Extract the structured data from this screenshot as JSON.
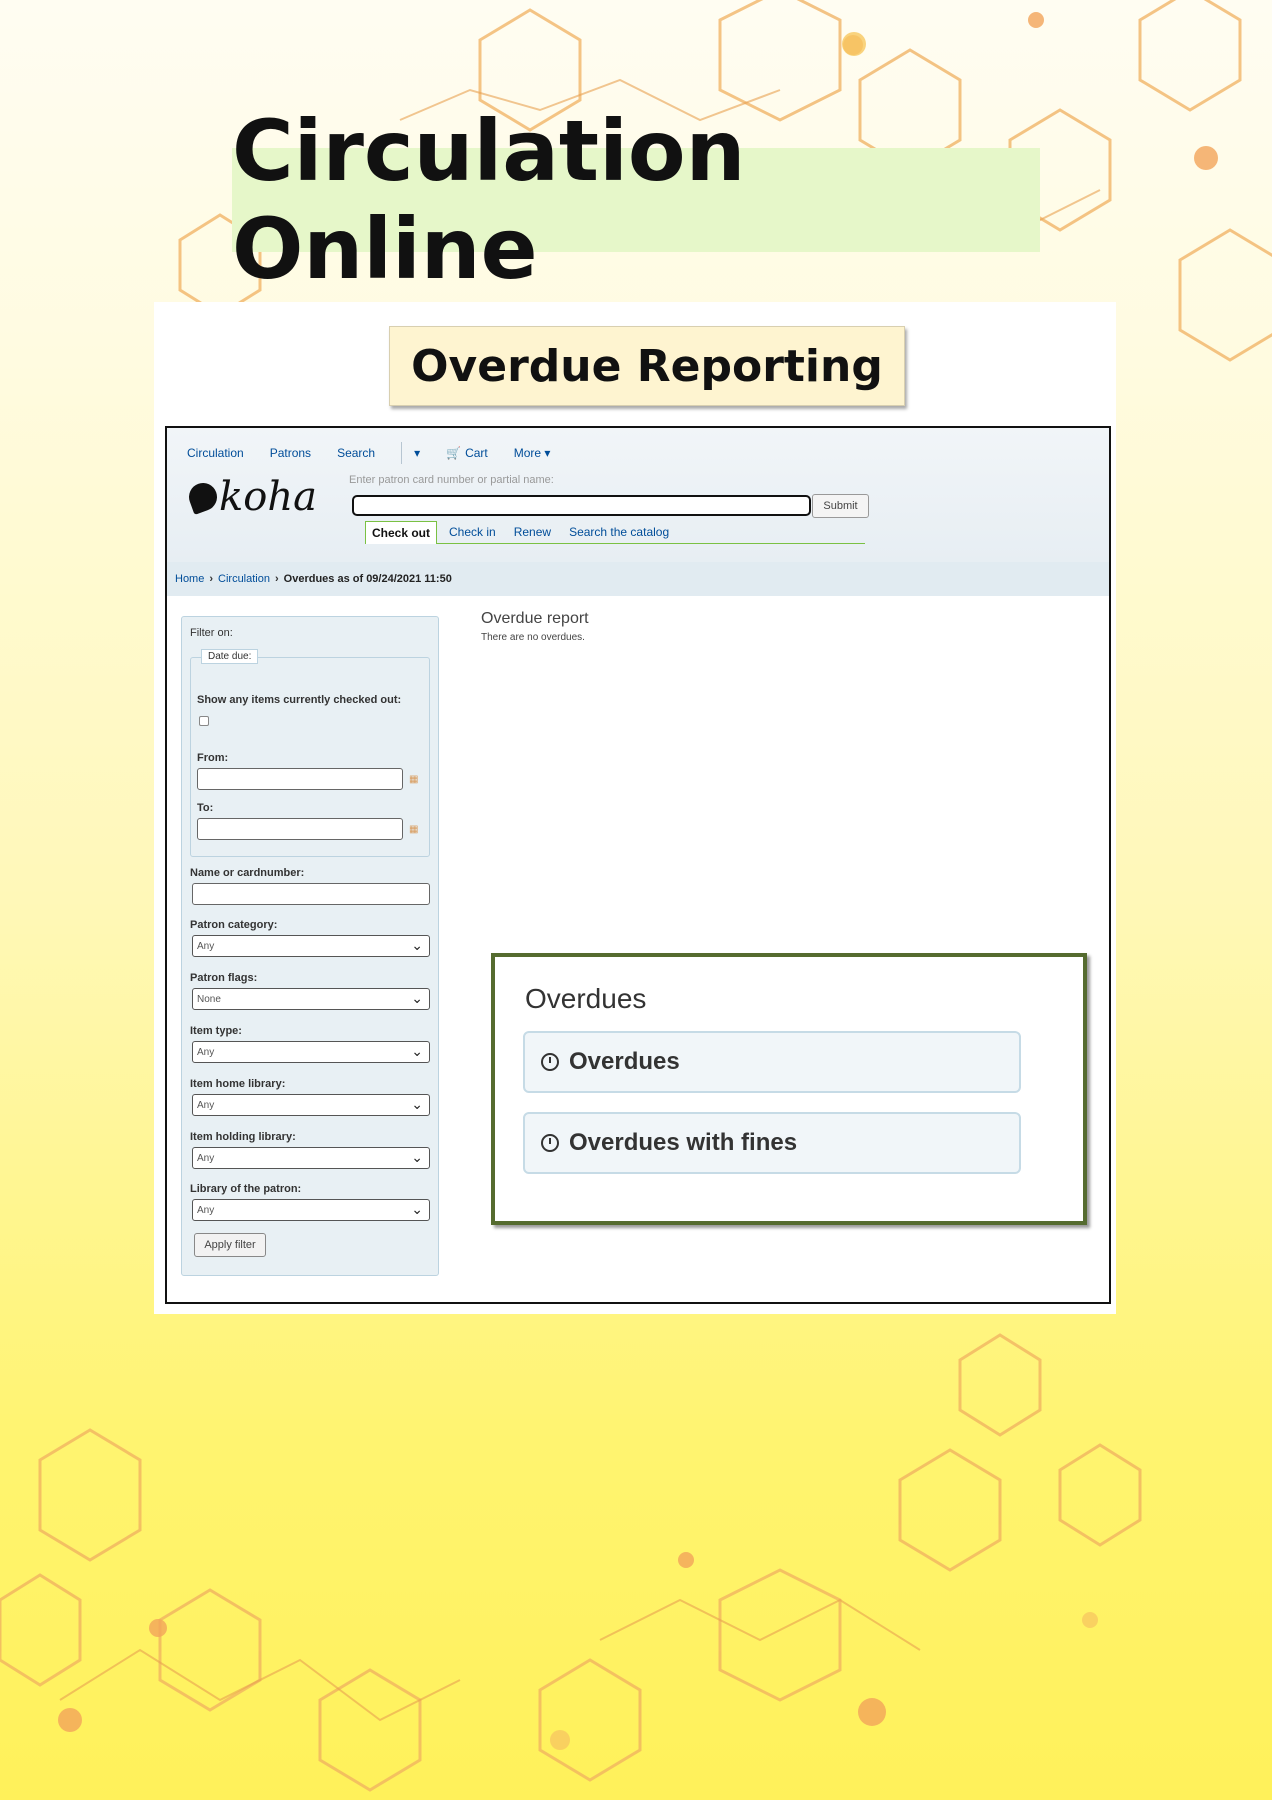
{
  "poster": {
    "title": "Circulation Online",
    "subtitle": "Overdue Reporting"
  },
  "colors": {
    "link": "#004d99",
    "title_highlight": "#e6f7c9",
    "overlay_border": "#556b2f",
    "active_tab_border": "#7ac143"
  },
  "koha": {
    "nav": {
      "circulation": "Circulation",
      "patrons": "Patrons",
      "search": "Search",
      "dropdown": "▾",
      "cart": "Cart",
      "more": "More ▾"
    },
    "logo_text": "koha",
    "search": {
      "hint": "Enter patron card number or partial name:",
      "value": "",
      "submit": "Submit"
    },
    "tabs": {
      "checkout": "Check out",
      "checkin": "Check in",
      "renew": "Renew",
      "catalog": "Search the catalog"
    },
    "breadcrumb": {
      "home": "Home",
      "circulation": "Circulation",
      "current": "Overdues as of 09/24/2021 11:50"
    },
    "filter": {
      "heading": "Filter on:",
      "legend": "Date due:",
      "show_checked_out": "Show any items currently checked out:",
      "from": "From:",
      "to": "To:",
      "name_or_card": "Name or cardnumber:",
      "patron_category": "Patron category:",
      "patron_category_value": "Any",
      "patron_flags": "Patron flags:",
      "patron_flags_value": "None",
      "item_type": "Item type:",
      "item_type_value": "Any",
      "home_library": "Item home library:",
      "home_library_value": "Any",
      "holding_library": "Item holding library:",
      "holding_library_value": "Any",
      "patron_library": "Library of the patron:",
      "patron_library_value": "Any",
      "apply": "Apply filter"
    },
    "report": {
      "title": "Overdue report",
      "message": "There are no overdues."
    }
  },
  "overdues_panel": {
    "title": "Overdues",
    "link1": "Overdues",
    "link2": "Overdues with fines"
  }
}
